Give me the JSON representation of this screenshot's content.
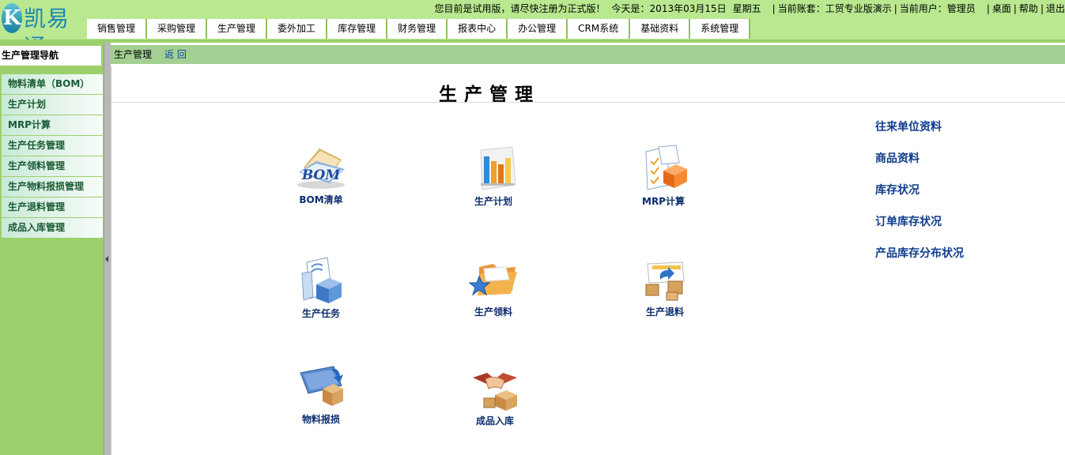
{
  "logo": {
    "mark": "K",
    "text": "凯易通"
  },
  "header": {
    "notice": "您目前是试用版，请尽快注册为正式版！",
    "date_prefix": "今天是：",
    "date": "2013年03月15日",
    "weekday": "星期五",
    "account_label": "当前账套：",
    "account": "工贸专业版演示",
    "user_label": "当前用户：",
    "user": "管理员",
    "links": [
      "桌面",
      "帮助",
      "退出"
    ]
  },
  "nav": {
    "tabs": [
      "销售管理",
      "采购管理",
      "生产管理",
      "委外加工",
      "库存管理",
      "财务管理",
      "报表中心",
      "办公管理",
      "CRM系统",
      "基础资料",
      "系统管理"
    ]
  },
  "sidebar": {
    "title": "生产管理导航",
    "items": [
      "物料清单（BOM）",
      "生产计划",
      "MRP计算",
      "生产任务管理",
      "生产领料管理",
      "生产物料报损管理",
      "生产退料管理",
      "成品入库管理"
    ]
  },
  "breadcrumb": {
    "current": "生产管理",
    "back": "返 回"
  },
  "main": {
    "title": "生产管理",
    "tiles": [
      {
        "label": "BOM清单",
        "icon": "bom-icon",
        "badge": "BOM"
      },
      {
        "label": "生产计划",
        "icon": "bar-chart-icon"
      },
      {
        "label": "MRP计算",
        "icon": "mrp-calc-icon"
      },
      {
        "label": "生产任务",
        "icon": "task-document-icon"
      },
      {
        "label": "生产领料",
        "icon": "folder-star-icon"
      },
      {
        "label": "生产退料",
        "icon": "return-boxes-icon"
      },
      {
        "label": "物料报损",
        "icon": "scrap-boxes-icon"
      },
      {
        "label": "成品入库",
        "icon": "handshake-boxes-icon"
      }
    ],
    "quick_links": [
      "往来单位资料",
      "商品资料",
      "库存状况",
      "订单库存状况",
      "产品库存分布状况"
    ]
  },
  "colors": {
    "header_bg": "#b9e890",
    "breadcrumb_bg": "#a3cf92",
    "sidebar_bg": "#9bd06d",
    "link_blue": "#0f3c8c",
    "tile_label": "#0d2d6e",
    "sidebar_text": "#1a5b33"
  }
}
